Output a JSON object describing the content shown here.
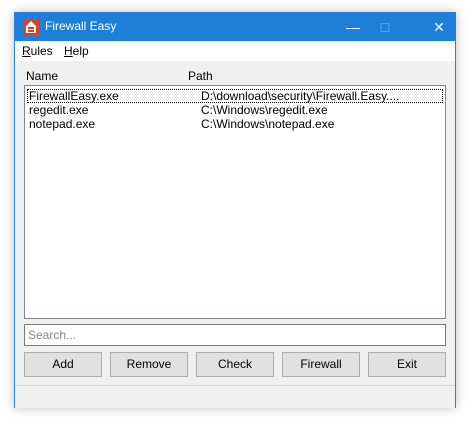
{
  "window": {
    "title": "Firewall Easy",
    "accent_color": "#1e7fd9"
  },
  "menu": {
    "rules": {
      "mnemonic": "R",
      "rest": "ules"
    },
    "help": {
      "mnemonic": "H",
      "rest": "elp"
    }
  },
  "columns": {
    "name": "Name",
    "path": "Path"
  },
  "rows": [
    {
      "name": "FirewallEasy.exe",
      "path": "D:\\download\\security\\Firewall.Easy...."
    },
    {
      "name": "regedit.exe",
      "path": "C:\\Windows\\regedit.exe"
    },
    {
      "name": "notepad.exe",
      "path": "C:\\Windows\\notepad.exe"
    }
  ],
  "search": {
    "placeholder": "Search..."
  },
  "buttons": {
    "add": "Add",
    "remove": "Remove",
    "check": "Check",
    "firewall": "Firewall",
    "exit": "Exit"
  }
}
